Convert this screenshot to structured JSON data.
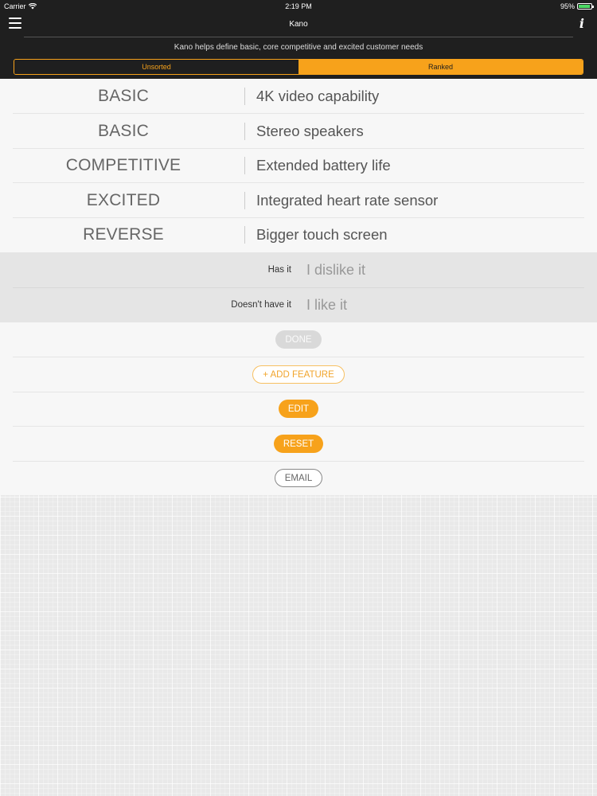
{
  "status_bar": {
    "carrier": "Carrier",
    "time": "2:19 PM",
    "battery": "95%",
    "battery_level": 0.95
  },
  "nav": {
    "title": "Kano",
    "subtitle": "Kano helps define basic, core competitive and excited customer needs",
    "menu_icon": "hamburger-menu-icon",
    "info_icon": "info-icon",
    "info_glyph": "i"
  },
  "tabs": {
    "unsorted": "Unsorted",
    "ranked": "Ranked",
    "selected": "Ranked"
  },
  "features": [
    {
      "category": "BASIC",
      "name": "4K video capability"
    },
    {
      "category": "BASIC",
      "name": "Stereo speakers"
    },
    {
      "category": "COMPETITIVE",
      "name": "Extended battery life"
    },
    {
      "category": "EXCITED",
      "name": "Integrated heart rate sensor"
    },
    {
      "category": "REVERSE",
      "name": "Bigger touch screen"
    }
  ],
  "answers": [
    {
      "label": "Has it",
      "value": "I dislike it"
    },
    {
      "label": "Doesn't have it",
      "value": "I like it"
    }
  ],
  "actions": {
    "done": "DONE",
    "add_feature": "+ ADD FEATURE",
    "edit": "EDIT",
    "reset": "RESET",
    "email": "EMAIL"
  },
  "colors": {
    "accent": "#f7a21b",
    "topbar": "#1f1f1f",
    "background": "#e9e9e9"
  }
}
